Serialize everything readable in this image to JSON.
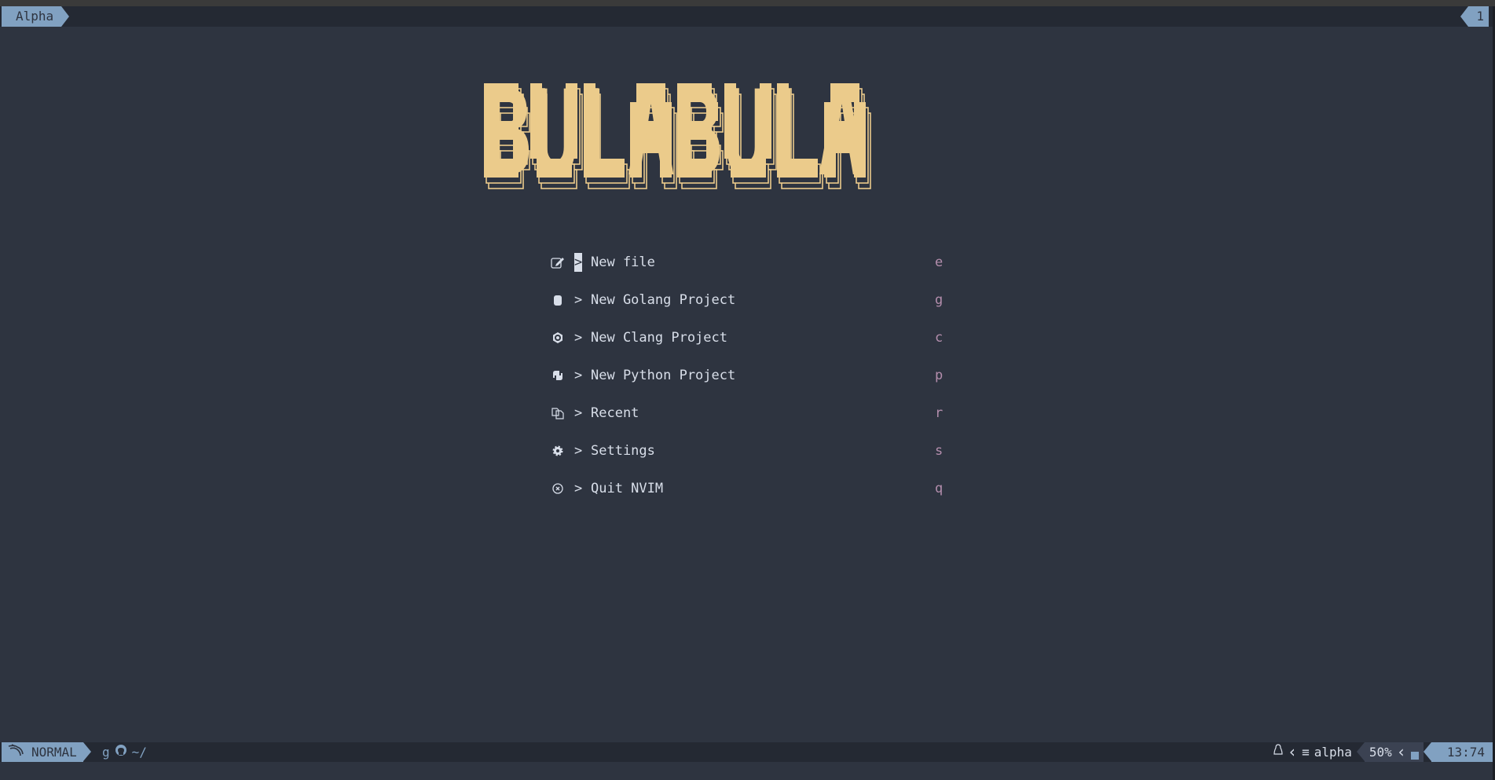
{
  "tabline": {
    "active_tab": "Alpha",
    "tab_count": "1"
  },
  "banner": {
    "text": "BULABULA",
    "color": "#ebcb8b"
  },
  "menu": [
    {
      "icon": "edit-icon",
      "label": "New file",
      "key": "e",
      "selected": true
    },
    {
      "icon": "gopher-icon",
      "label": "New Golang Project",
      "key": "g"
    },
    {
      "icon": "c-language-icon",
      "label": "New Clang Project",
      "key": "c"
    },
    {
      "icon": "python-icon",
      "label": "New Python Project",
      "key": "p"
    },
    {
      "icon": "recent-files-icon",
      "label": "Recent",
      "key": "r"
    },
    {
      "icon": "gear-icon",
      "label": "Settings",
      "key": "s"
    },
    {
      "icon": "close-circle-icon",
      "label": "Quit NVIM",
      "key": "q"
    }
  ],
  "menu_prefix": ">",
  "statusline": {
    "mode": "NORMAL",
    "branch": "g",
    "cwd": "~/",
    "filetype": "alpha",
    "percent": "50%",
    "position": "13:74"
  },
  "colors": {
    "background": "#2e3440",
    "accent": "#81a1c1",
    "key": "#b48ead",
    "text": "#d8dee9"
  }
}
